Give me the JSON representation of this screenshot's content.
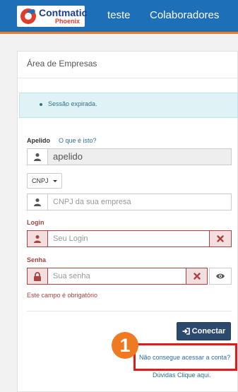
{
  "header": {
    "logo_name": "Contmatic",
    "logo_sub": "Phoenix",
    "nav": [
      "teste",
      "Colaboradores"
    ],
    "bar_color": "#1d6fb8",
    "accent_color": "#f07a22"
  },
  "card": {
    "title": "Área de Empresas",
    "alert_text": "Sessão expirada."
  },
  "form": {
    "apelido_label": "Apelido",
    "apelido_help": "O que é isto?",
    "apelido_value": "apelido",
    "apelido_icon": "user-icon",
    "doc_type": "CNPJ",
    "cnpj_placeholder": "CNPJ da sua empresa",
    "cnpj_icon": "user-icon",
    "login_label": "Login",
    "login_placeholder": "Seu Login",
    "login_icon": "user-icon",
    "login_clear_icon": "clear-icon",
    "senha_label": "Senha",
    "senha_placeholder": "Sua senha",
    "senha_icon": "lock-icon",
    "senha_clear_icon": "clear-icon",
    "senha_show_icon": "eye-icon",
    "error_message": "Este campo é obrigatório",
    "error_color": "#a94442"
  },
  "actions": {
    "connect_label": "Conectar",
    "connect_icon": "sign-in-icon",
    "step_number": "1",
    "forgot_link": "Não consegue acessar a conta?",
    "help_link": "Dúvidas Clique aqui."
  }
}
